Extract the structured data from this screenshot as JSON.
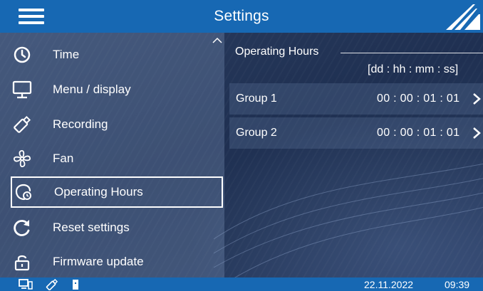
{
  "header": {
    "title": "Settings"
  },
  "sidebar": {
    "items": [
      {
        "label": "Time",
        "icon": "clock-icon"
      },
      {
        "label": "Menu / display",
        "icon": "monitor-icon"
      },
      {
        "label": "Recording",
        "icon": "usb-stick-icon"
      },
      {
        "label": "Fan",
        "icon": "fan-icon"
      },
      {
        "label": "Operating Hours",
        "icon": "operating-hours-icon",
        "selected": true
      },
      {
        "label": "Reset settings",
        "icon": "reset-icon"
      },
      {
        "label": "Firmware update",
        "icon": "lock-icon"
      }
    ]
  },
  "panel": {
    "title": "Operating Hours",
    "units": "[dd : hh : mm : ss]",
    "groups": [
      {
        "name": "Group 1",
        "value": "00 : 00 : 01 : 01"
      },
      {
        "name": "Group 2",
        "value": "00 : 00 : 01 : 01"
      }
    ]
  },
  "status": {
    "date": "22.11.2022",
    "time": "09:39"
  },
  "colors": {
    "bar": "#1768b3",
    "background": "#1f3052",
    "text": "#ffffff"
  }
}
